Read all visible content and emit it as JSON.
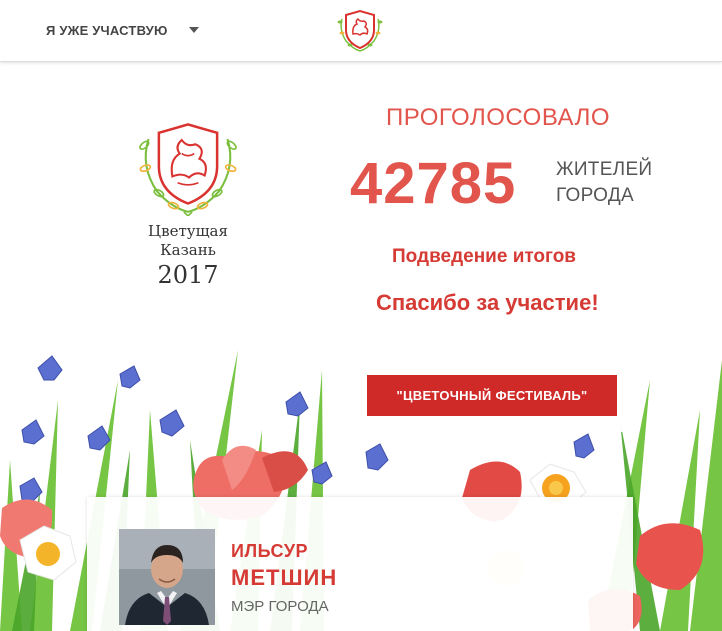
{
  "header": {
    "participate_label": "Я УЖЕ УЧАСТВУЮ",
    "dropdown_icon": "caret-down-icon",
    "logo_icon": "tatarstan-dragon-emblem-icon"
  },
  "logo": {
    "line1": "Цветущая",
    "line2": "Казань",
    "year": "2017"
  },
  "stats": {
    "voted_label": "ПРОГОЛОСОВАЛО",
    "count": "42785",
    "residents_line1": "ЖИТЕЛЕЙ",
    "residents_line2": "ГОРОДА",
    "results_label": "Подведение итогов",
    "thanks_label": "Спасибо за участие!"
  },
  "festival": {
    "button_label": "\"ЦВЕТОЧНЫЙ ФЕСТИВАЛЬ\""
  },
  "mayor": {
    "first_name": "ИЛЬСУР",
    "last_name": "МЕТШИН",
    "role": "МЭР ГОРОДА"
  },
  "colors": {
    "accent_red": "#e2554d",
    "button_red": "#cf2a28",
    "emblem_red": "#d9322f",
    "emblem_green": "#7cbf3f"
  }
}
